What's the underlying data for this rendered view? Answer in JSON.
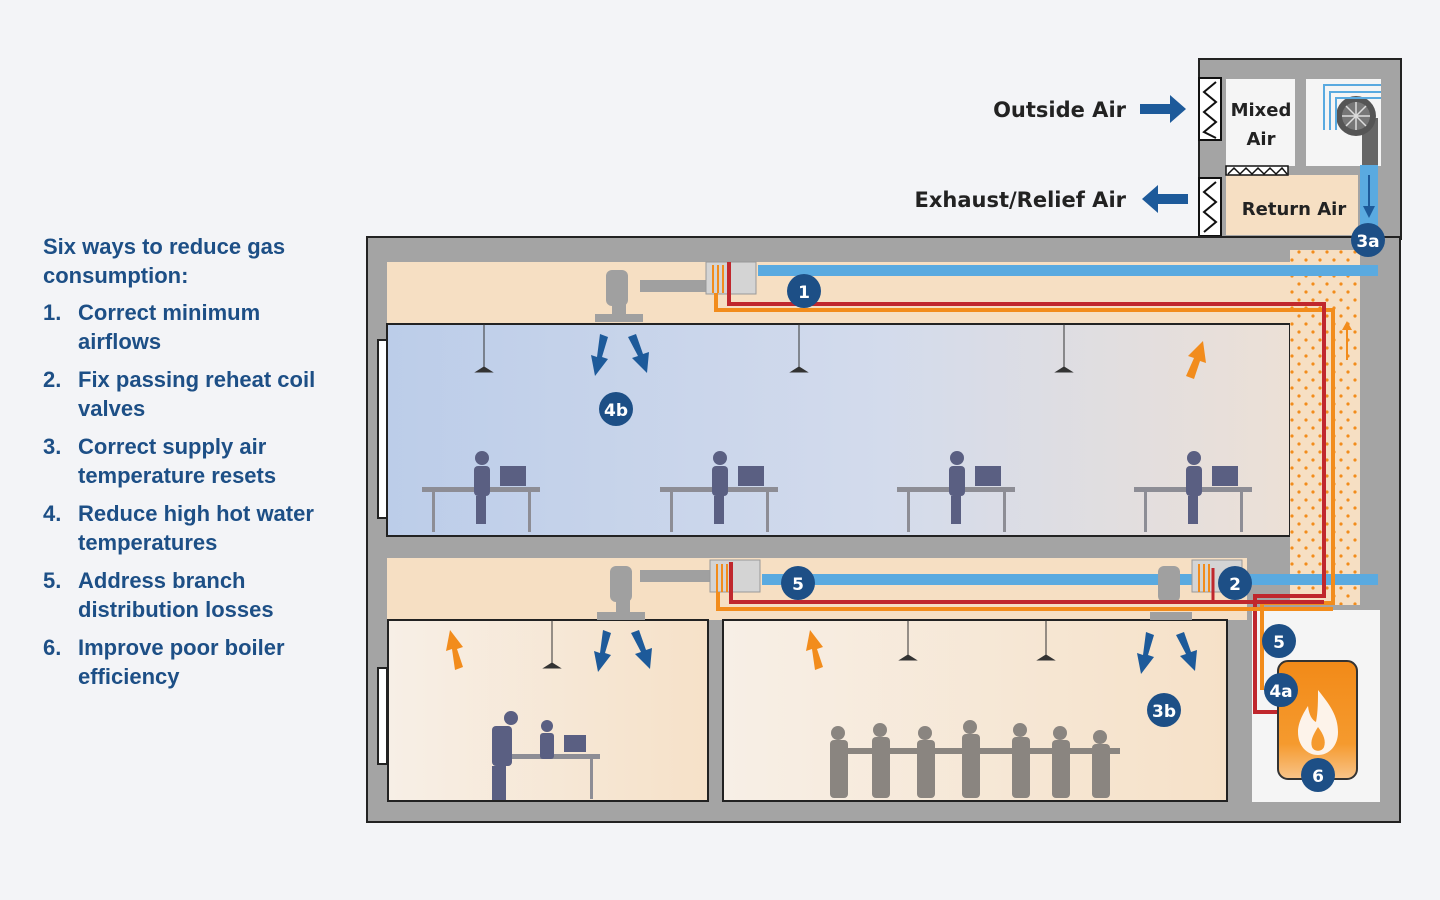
{
  "legend": {
    "title": "Six ways to reduce gas consumption:",
    "items": [
      {
        "num": "1.",
        "text": "Correct minimum airflows"
      },
      {
        "num": "2.",
        "text": "Fix passing reheat coil valves"
      },
      {
        "num": "3.",
        "text": "Correct supply air temperature resets"
      },
      {
        "num": "4.",
        "text": "Reduce high hot water temperatures"
      },
      {
        "num": "5.",
        "text": "Address branch distribution losses"
      },
      {
        "num": "6.",
        "text": "Improve poor boiler efficiency"
      }
    ]
  },
  "labels": {
    "outside_air": "Outside Air",
    "exhaust_air": "Exhaust/Relief Air",
    "mixed_air_1": "Mixed",
    "mixed_air_2": "Air",
    "return_air": "Return Air"
  },
  "badges": {
    "b1": "1",
    "b2": "2",
    "b3a": "3a",
    "b3b": "3b",
    "b4a": "4a",
    "b4b": "4b",
    "b5_top": "5",
    "b5_side": "5",
    "b6": "6"
  },
  "colors": {
    "badge": "#1d4f86",
    "supply_air": "#5aaae0",
    "hot_water_supply": "#c0272d",
    "hot_water_return": "#f28c1c",
    "plenum": "#f6dfc3",
    "cool_zone": "#bfd0ea",
    "wall": "#a4a4a4",
    "boiler": "#f28c1c"
  },
  "icons": {
    "fan": "fan-icon",
    "flame": "flame-icon",
    "damper": "damper-icon",
    "arrow": "airflow-arrow-icon"
  }
}
